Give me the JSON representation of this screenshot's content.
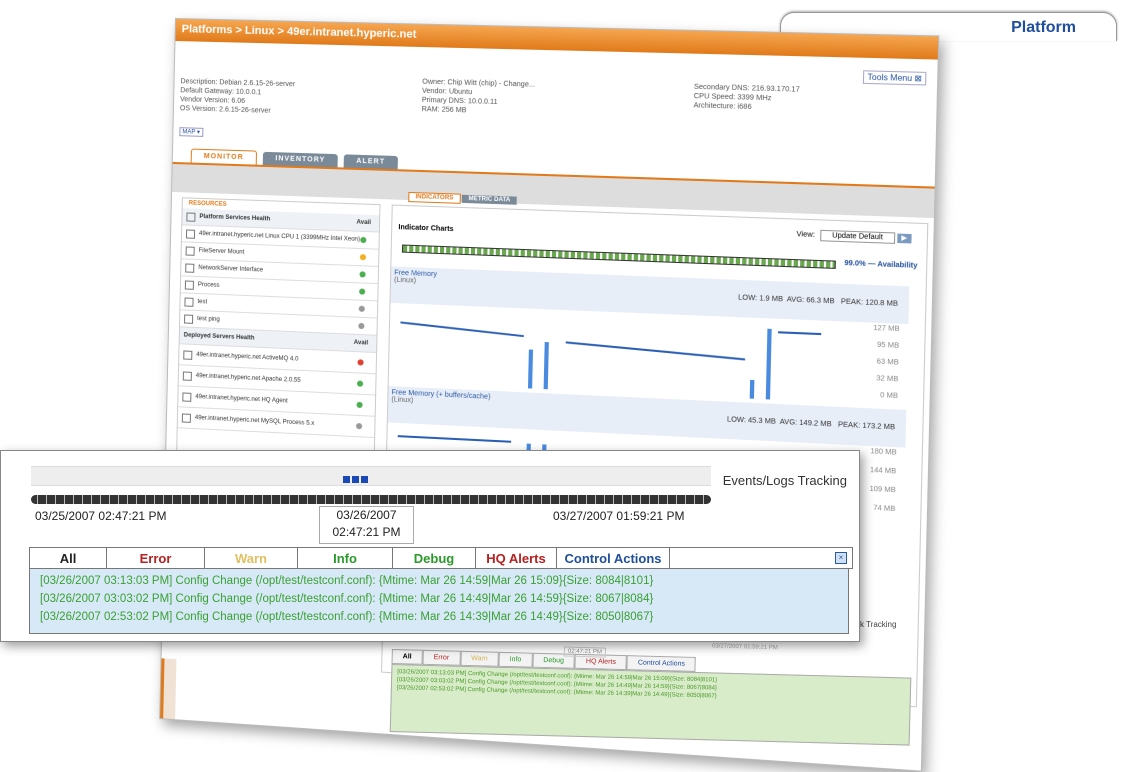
{
  "app": {
    "breadcrumb": "Platforms > Linux > 49er.intranet.hyperic.net",
    "platform_label": "Platform",
    "tools_menu": "Tools Menu",
    "details_left": "Description: Debian 2.6.15-26-server\nDefault Gateway: 10.0.0.1\nVendor Version: 6.06\nOS Version: 2.6.15-26-server",
    "details_mid": "Owner: Chip Witt (chip) - Change...\nVendor: Ubuntu\nPrimary DNS: 10.0.0.11\nRAM: 256 MB",
    "details_right": "Secondary DNS: 216.93.170.17\nCPU Speed: 3399 MHz\nArchitecture: i686",
    "map_button": "MAP",
    "tabs": [
      "MONITOR",
      "INVENTORY",
      "ALERT"
    ],
    "left_panel": {
      "tab": "RESOURCES",
      "section1_title": "Platform Services Health",
      "avail": "Avail",
      "rows1": [
        "49er.intranet.hyperic.net Linux CPU 1 (3399MHz Intel Xeon)",
        "FileServer Mount",
        "NetworkServer Interface",
        "Process",
        "test",
        "test ping"
      ],
      "section2_title": "Deployed Servers Health",
      "rows2": [
        "49er.intranet.hyperic.net ActiveMQ 4.0",
        "49er.intranet.hyperic.net Apache 2.0.55",
        "49er.intranet.hyperic.net HQ Agent",
        "49er.intranet.hyperic.net MySQL Process 5.x"
      ]
    },
    "right_panel": {
      "tabs": [
        "INDICATORS",
        "METRIC DATA"
      ],
      "title": "Indicator Charts",
      "view_label": "View:",
      "view_value": "Update Default",
      "availability": "99.0% — Availability",
      "chart1": {
        "name": "Free Memory",
        "unit": "(Linux)",
        "low": "LOW: 1.9 MB",
        "avg": "AVG: 66.3 MB",
        "peak": "PEAK: 120.8 MB",
        "y_ticks": [
          "127 MB",
          "95 MB",
          "63 MB",
          "32 MB",
          "0 MB"
        ]
      },
      "chart2": {
        "name": "Free Memory (+ buffers/cache)",
        "unit": "(Linux)",
        "low": "LOW: 45.3 MB",
        "avg": "AVG: 149.2 MB",
        "peak": "PEAK: 173.2 MB",
        "y_ticks": [
          "180 MB",
          "144 MB",
          "109 MB",
          "74 MB"
        ]
      }
    }
  },
  "zoom": {
    "title": "Events/Logs Tracking",
    "start_time": "03/25/2007 02:47:21 PM",
    "end_time": "03/27/2007 01:59:21 PM",
    "marker_date": "03/26/2007",
    "marker_time": "02:47:21 PM",
    "tabs": [
      {
        "label": "All",
        "color": "#222222"
      },
      {
        "label": "Error",
        "color": "#b52020"
      },
      {
        "label": "Warn",
        "color": "#e0c060"
      },
      {
        "label": "Info",
        "color": "#2a9a2a"
      },
      {
        "label": "Debug",
        "color": "#2a9a2a"
      },
      {
        "label": "HQ Alerts",
        "color": "#b52020"
      },
      {
        "label": "Control Actions",
        "color": "#1f4e9c"
      }
    ],
    "logs": [
      "[03/26/2007 03:13:03 PM] Config Change (/opt/test/testconf.conf): {Mtime: Mar 26 14:59|Mar 26 15:09}{Size: 8084|8101}",
      "[03/26/2007 03:03:02 PM] Config Change (/opt/test/testconf.conf): {Mtime: Mar 26 14:49|Mar 26 14:59}{Size: 8067|8084}",
      "[03/26/2007 02:53:02 PM] Config Change (/opt/test/testconf.conf): {Mtime: Mar 26 14:39|Mar 26 14:49}{Size: 8050|8067}"
    ]
  },
  "bottom_faded": {
    "tabs": [
      "All",
      "Error",
      "Warn",
      "Info",
      "Debug",
      "HQ Alerts",
      "Control Actions"
    ],
    "logs": [
      "[03/26/2007 03:13:03 PM] Config Change (/opt/test/testconf.conf): {Mtime: Mar 26 14:59|Mar 26 15:09}{Size: 8084|8101}",
      "[03/26/2007 03:03:02 PM] Config Change (/opt/test/testconf.conf): {Mtime: Mar 26 14:49|Mar 26 14:59}{Size: 8067|8084}",
      "[03/26/2007 02:53:02 PM] Config Change (/opt/test/testconf.conf): {Mtime: Mar 26 14:39|Mar 26 14:49}{Size: 8050|8067}"
    ],
    "side_label": "k Tracking",
    "faded_time": "02:47:21 PM",
    "faded_end": "03/27/2007 01:59:21 PM"
  }
}
